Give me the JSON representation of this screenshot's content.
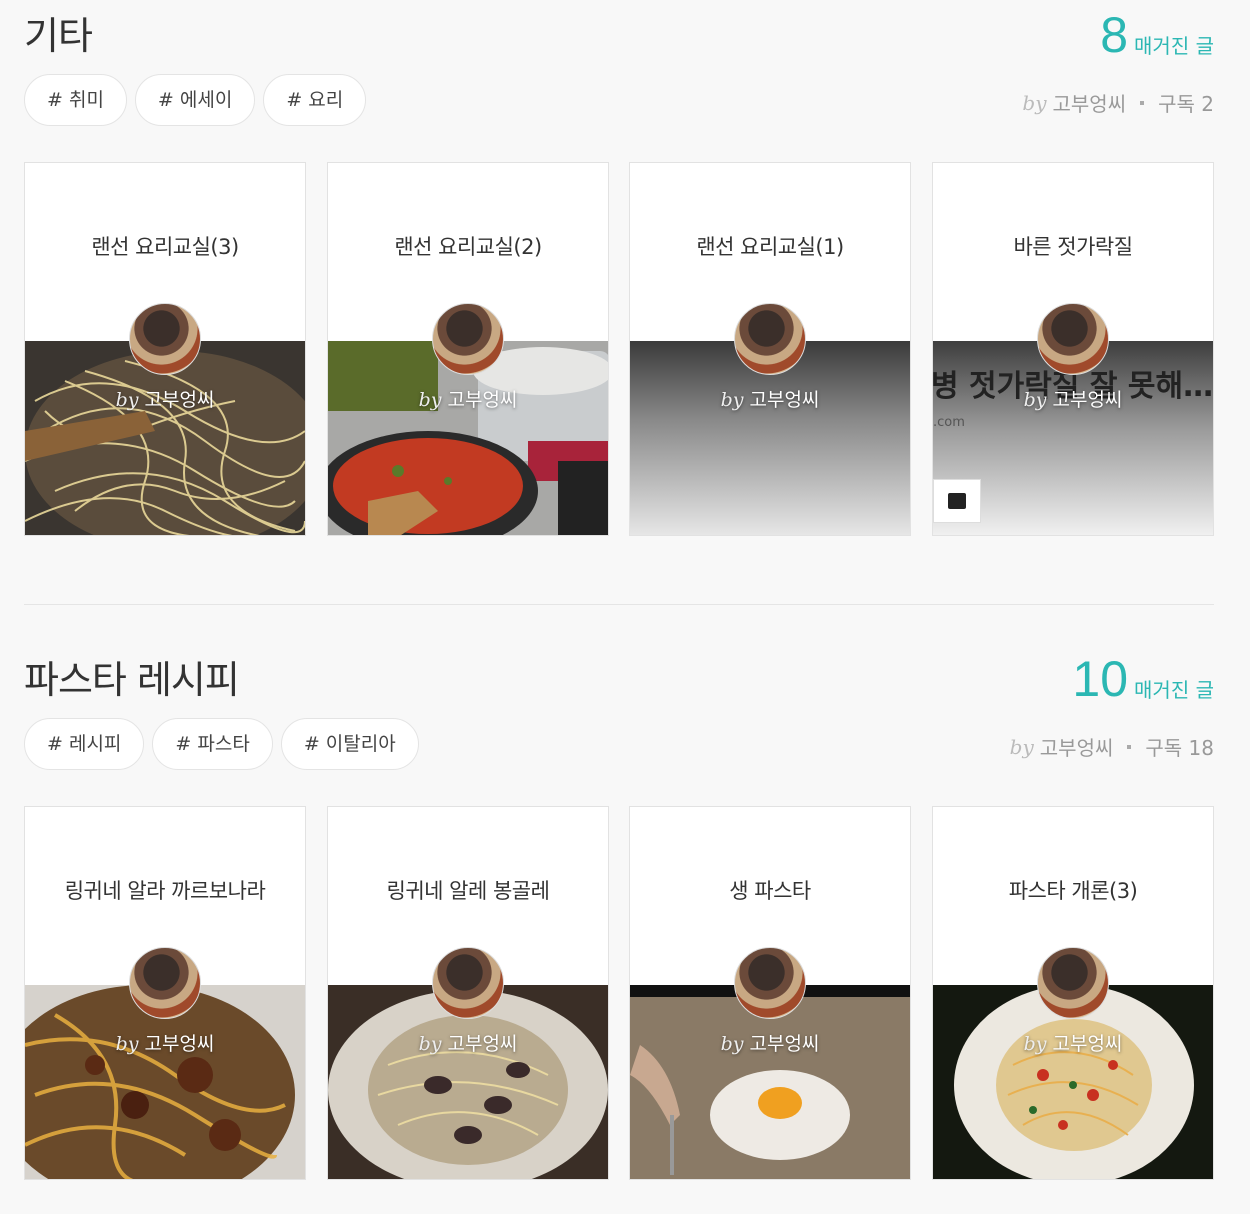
{
  "sections": [
    {
      "title": "기타",
      "count": "8",
      "count_label": "매거진 글",
      "tags": [
        "# 취미",
        "# 에세이",
        "# 요리"
      ],
      "meta": {
        "by": "by",
        "author": "고부엉씨",
        "subscribe": "구독 2"
      },
      "cards": [
        {
          "title": "랜선 요리교실(3)",
          "by": "by",
          "author": "고부엉씨",
          "image": "spaghetti-pan"
        },
        {
          "title": "랜선 요리교실(2)",
          "by": "by",
          "author": "고부엉씨",
          "image": "tomato-sauce-pan"
        },
        {
          "title": "랜선 요리교실(1)",
          "by": "by",
          "author": "고부엉씨",
          "image": "grey-gradient"
        },
        {
          "title": "바른 젓가락질",
          "by": "by",
          "author": "고부엉씨",
          "image": "screenshot",
          "image_text": "병 젓가락질 잘 못해…\"",
          "image_subtext": ".com"
        }
      ]
    },
    {
      "title": "파스타 레시피",
      "count": "10",
      "count_label": "매거진 글",
      "tags": [
        "# 레시피",
        "# 파스타",
        "# 이탈리아"
      ],
      "meta": {
        "by": "by",
        "author": "고부엉씨",
        "subscribe": "구독 18"
      },
      "cards": [
        {
          "title": "링귀네 알라 까르보나라",
          "by": "by",
          "author": "고부엉씨",
          "image": "carbonara"
        },
        {
          "title": "링귀네 알레 봉골레",
          "by": "by",
          "author": "고부엉씨",
          "image": "vongole"
        },
        {
          "title": "생 파스타",
          "by": "by",
          "author": "고부엉씨",
          "image": "flour-egg"
        },
        {
          "title": "파스타 개론(3)",
          "by": "by",
          "author": "고부엉씨",
          "image": "tomato-plate"
        }
      ]
    }
  ]
}
